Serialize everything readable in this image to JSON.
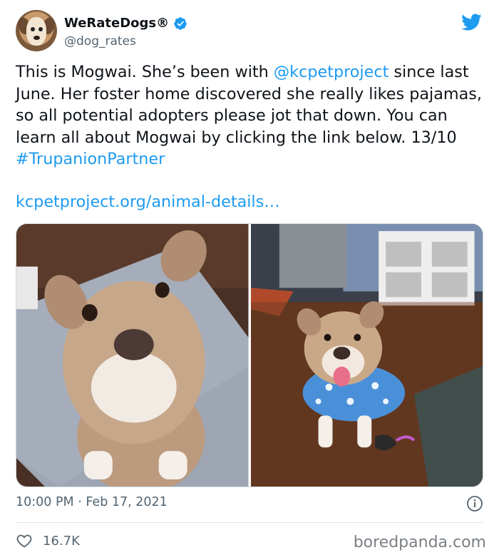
{
  "author": {
    "display_name": "WeRateDogs®",
    "handle": "@dog_rates",
    "avatar_icon": "dog-avatar",
    "verified_icon": "verified-badge-icon",
    "platform_icon": "twitter-bird-icon"
  },
  "tweet": {
    "text_1": "This is Mogwai. She’s been with ",
    "mention": "@kcpetproject",
    "text_2": " since last June. Her foster home discovered she really likes pajamas, so all potential adopters please jot that down. You can learn all about Mogwai by clicking the link below. 13/10 ",
    "hashtag": "#TrupanionPartner",
    "url": "kcpetproject.org/animal-details…"
  },
  "media": {
    "photo_left_icon": "dog-closeup-photo",
    "photo_right_icon": "dog-in-pajamas-photo"
  },
  "meta": {
    "timestamp": "10:00 PM · Feb 17, 2021",
    "info_icon": "info-icon"
  },
  "engagement": {
    "like_icon": "heart-icon",
    "like_count": "16.7K"
  },
  "watermark": "boredpanda.com",
  "colors": {
    "link": "#1d9bf0",
    "secondary_text": "#536471",
    "primary_text": "#0f1419"
  }
}
